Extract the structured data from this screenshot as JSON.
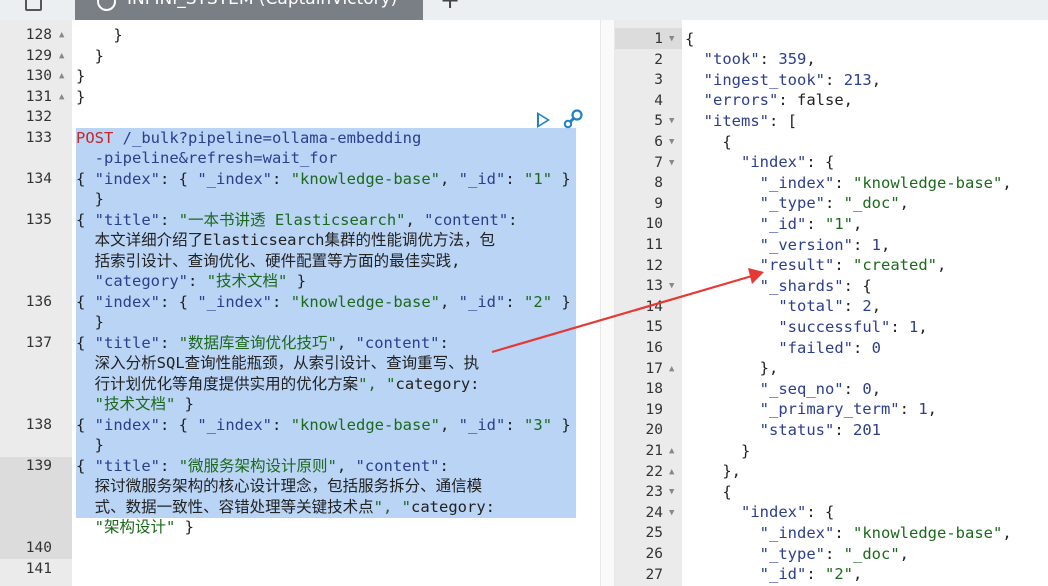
{
  "tab": {
    "title": "INFINI_SYSTEM (CaptainVictory)"
  },
  "request": {
    "line_numbers": [
      "128",
      "129",
      "130",
      "131",
      "132",
      "133",
      "134",
      "135",
      "136",
      "137",
      "138",
      "139",
      "140",
      "141"
    ],
    "lines": {
      "l128": "    }",
      "l129": "  }",
      "l130": "}",
      "l131": "}",
      "l133a_method": "POST",
      "l133a_url": " /_bulk?pipeline=ollama-embedding",
      "l133b": "  -pipeline&refresh=wait_for",
      "l134": "{ \"index\": { \"_index\": \"knowledge-base\", \"_id\": \"1\" }",
      "l134b": "  }",
      "l135a": "{ \"title\": \"一本书讲透 Elasticsearch\", \"content\":",
      "l135b": "  \"本文详细介绍了Elasticsearch集群的性能调优方法，包",
      "l135c": "  括索引设计、查询优化、硬件配置等方面的最佳实践\",",
      "l135d": "  \"category\": \"技术文档\" }",
      "l136": "{ \"index\": { \"_index\": \"knowledge-base\", \"_id\": \"2\" }",
      "l136b": "  }",
      "l137a": "{ \"title\": \"数据库查询优化技巧\", \"content\":",
      "l137b": "  \"深入分析SQL查询性能瓶颈，从索引设计、查询重写、执",
      "l137c": "  行计划优化等角度提供实用的优化方案\", \"category\":",
      "l137d": "  \"技术文档\" }",
      "l138": "{ \"index\": { \"_index\": \"knowledge-base\", \"_id\": \"3\" }",
      "l138b": "  }",
      "l139a": "{ \"title\": \"微服务架构设计原则\", \"content\":",
      "l139b": "  \"探讨微服务架构的核心设计理念，包括服务拆分、通信模",
      "l139c": "  式、数据一致性、容错处理等关键技术点\", \"category\":",
      "l139d": "  \"架构设计\" }"
    }
  },
  "response": {
    "line_numbers": [
      "1",
      "2",
      "3",
      "4",
      "5",
      "6",
      "7",
      "8",
      "9",
      "10",
      "11",
      "12",
      "13",
      "14",
      "15",
      "16",
      "17",
      "18",
      "19",
      "20",
      "21",
      "22",
      "23",
      "24",
      "25",
      "26",
      "27"
    ],
    "lines": [
      "{",
      "  \"took\": 359,",
      "  \"ingest_took\": 213,",
      "  \"errors\": false,",
      "  \"items\": [",
      "    {",
      "      \"index\": {",
      "        \"_index\": \"knowledge-base\",",
      "        \"_type\": \"_doc\",",
      "        \"_id\": \"1\",",
      "        \"_version\": 1,",
      "        \"result\": \"created\",",
      "        \"_shards\": {",
      "          \"total\": 2,",
      "          \"successful\": 1,",
      "          \"failed\": 0",
      "        },",
      "        \"_seq_no\": 0,",
      "        \"_primary_term\": 1,",
      "        \"status\": 201",
      "      }",
      "    },",
      "    {",
      "      \"index\": {",
      "        \"_index\": \"knowledge-base\",",
      "        \"_type\": \"_doc\",",
      "        \"_id\": \"2\","
    ]
  },
  "colors": {
    "selection": "#b9d4f5",
    "arrow": "#e53935",
    "run": "#1f82c9"
  }
}
